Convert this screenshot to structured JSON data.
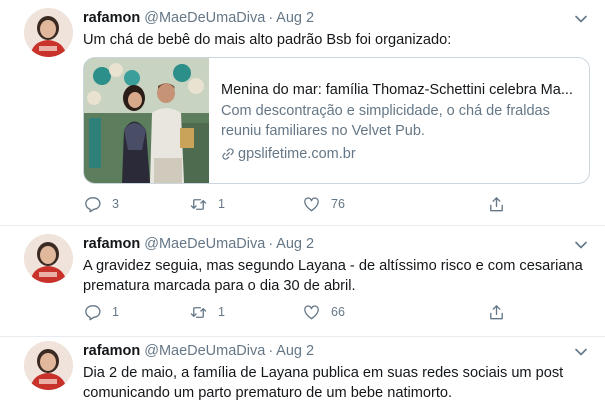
{
  "author": {
    "name": "rafamon",
    "handle": "@MaeDeUmaDiva",
    "avatar_icon": "avatar-photo"
  },
  "tweets": [
    {
      "date": "Aug 2",
      "text": "Um chá de bebê do mais alto padrão Bsb foi organizado:",
      "card": {
        "title": "Menina do mar: família Thomaz-Schettini celebra Ma...",
        "description": "Com descontração e simplicidade, o chá de fraldas reuniu familiares no Velvet Pub.",
        "domain": "gpslifetime.com.br"
      },
      "replies": "3",
      "retweets": "1",
      "likes": "76"
    },
    {
      "date": "Aug 2",
      "text": "A gravidez seguia, mas segundo Layana - de altíssimo risco e com cesariana prematura marcada para o dia 30 de abril.",
      "replies": "1",
      "retweets": "1",
      "likes": "66"
    },
    {
      "date": "Aug 2",
      "text": "Dia 2 de maio, a família de Layana publica em suas redes sociais um post comunicando um parto prematuro de um bebe natimorto."
    }
  ],
  "separator": "·",
  "colors": {
    "text": "#14171a",
    "secondary": "#657786",
    "border": "#ccd6dd",
    "divider": "#e6ecf0"
  }
}
